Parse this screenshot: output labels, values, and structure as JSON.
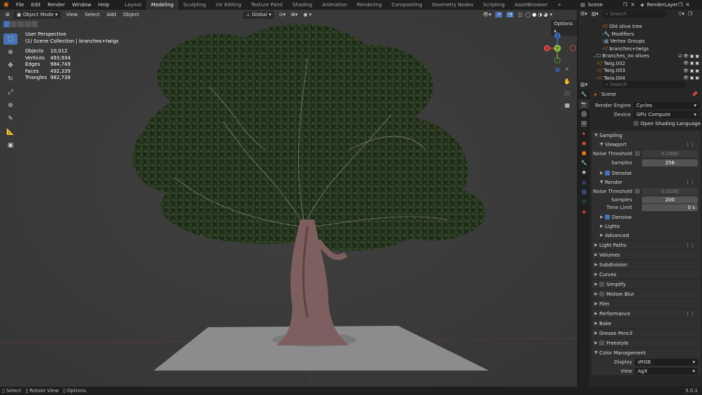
{
  "topbar": {
    "menu": [
      "File",
      "Edit",
      "Render",
      "Window",
      "Help"
    ],
    "workspaces": [
      {
        "label": "Layout",
        "active": false
      },
      {
        "label": "Modeling",
        "active": true
      },
      {
        "label": "Sculpting",
        "active": false
      },
      {
        "label": "UV Editing",
        "active": false
      },
      {
        "label": "Texture Paint",
        "active": false
      },
      {
        "label": "Shading",
        "active": false
      },
      {
        "label": "Animation",
        "active": false
      },
      {
        "label": "Rendering",
        "active": false
      },
      {
        "label": "Compositing",
        "active": false
      },
      {
        "label": "Geometry Nodes",
        "active": false
      },
      {
        "label": "Scripting",
        "active": false
      },
      {
        "label": "AssetBrowser",
        "active": false
      }
    ],
    "scene": "Scene",
    "render_layer": "RenderLayer"
  },
  "viewport": {
    "mode": "Object Mode",
    "menus": [
      "View",
      "Select",
      "Add",
      "Object"
    ],
    "transform": "Global",
    "options": "Options",
    "overlay_title": "User Perspective",
    "overlay_collection": "(1) Scene Collection | branches+twigs",
    "stats": [
      {
        "k": "Objects",
        "v": "10,012"
      },
      {
        "k": "Vertices",
        "v": "493,934"
      },
      {
        "k": "Edges",
        "v": "984,749"
      },
      {
        "k": "Faces",
        "v": "492,339"
      },
      {
        "k": "Triangles",
        "v": "982,738"
      }
    ],
    "gizmo": {
      "x": "X",
      "y": "Y",
      "z": "Z"
    }
  },
  "outliner": {
    "search_placeholder": "Search",
    "rows": [
      {
        "label": "Old olive tree",
        "indent": 34
      },
      {
        "label": "Modifiers",
        "indent": 34
      },
      {
        "label": "Vertex Groups",
        "indent": 34
      },
      {
        "label": "branches+twigs",
        "indent": 34
      },
      {
        "label": "Branches_no olives",
        "indent": 20
      },
      {
        "label": "Twig.002",
        "indent": 26
      },
      {
        "label": "Twig.003",
        "indent": 26
      },
      {
        "label": "Twig.004",
        "indent": 26
      }
    ]
  },
  "properties": {
    "search_placeholder": "Search",
    "context": "Scene",
    "render_engine_label": "Render Engine",
    "render_engine": "Cycles",
    "device_label": "Device",
    "device": "GPU Compute",
    "osl_label": "Open Shading Language",
    "sampling": "Sampling",
    "viewport": "Viewport",
    "noise_threshold_label": "Noise Threshold",
    "vp_noise": "0.1000",
    "samples_label": "Samples",
    "vp_samples": "256",
    "denoise": "Denoise",
    "render": "Render",
    "r_noise": "0.0100",
    "r_samples": "200",
    "time_limit_label": "Time Limit",
    "time_limit": "0 s",
    "lights": "Lights",
    "advanced": "Advanced",
    "sections": [
      "Light Paths",
      "Volumes",
      "Subdivision",
      "Curves"
    ],
    "simplify": "Simplify",
    "motion_blur": "Motion Blur",
    "sections2": [
      "Film",
      "Performance",
      "Bake",
      "Grease Pencil"
    ],
    "freestyle": "Freestyle",
    "color_management": "Color Management",
    "display_label": "Display",
    "display": "sRGB",
    "view_label": "View",
    "view": "AgX"
  },
  "status": {
    "select": "Select",
    "rotate": "Rotate View",
    "options": "Options",
    "version": "5.0.1"
  }
}
